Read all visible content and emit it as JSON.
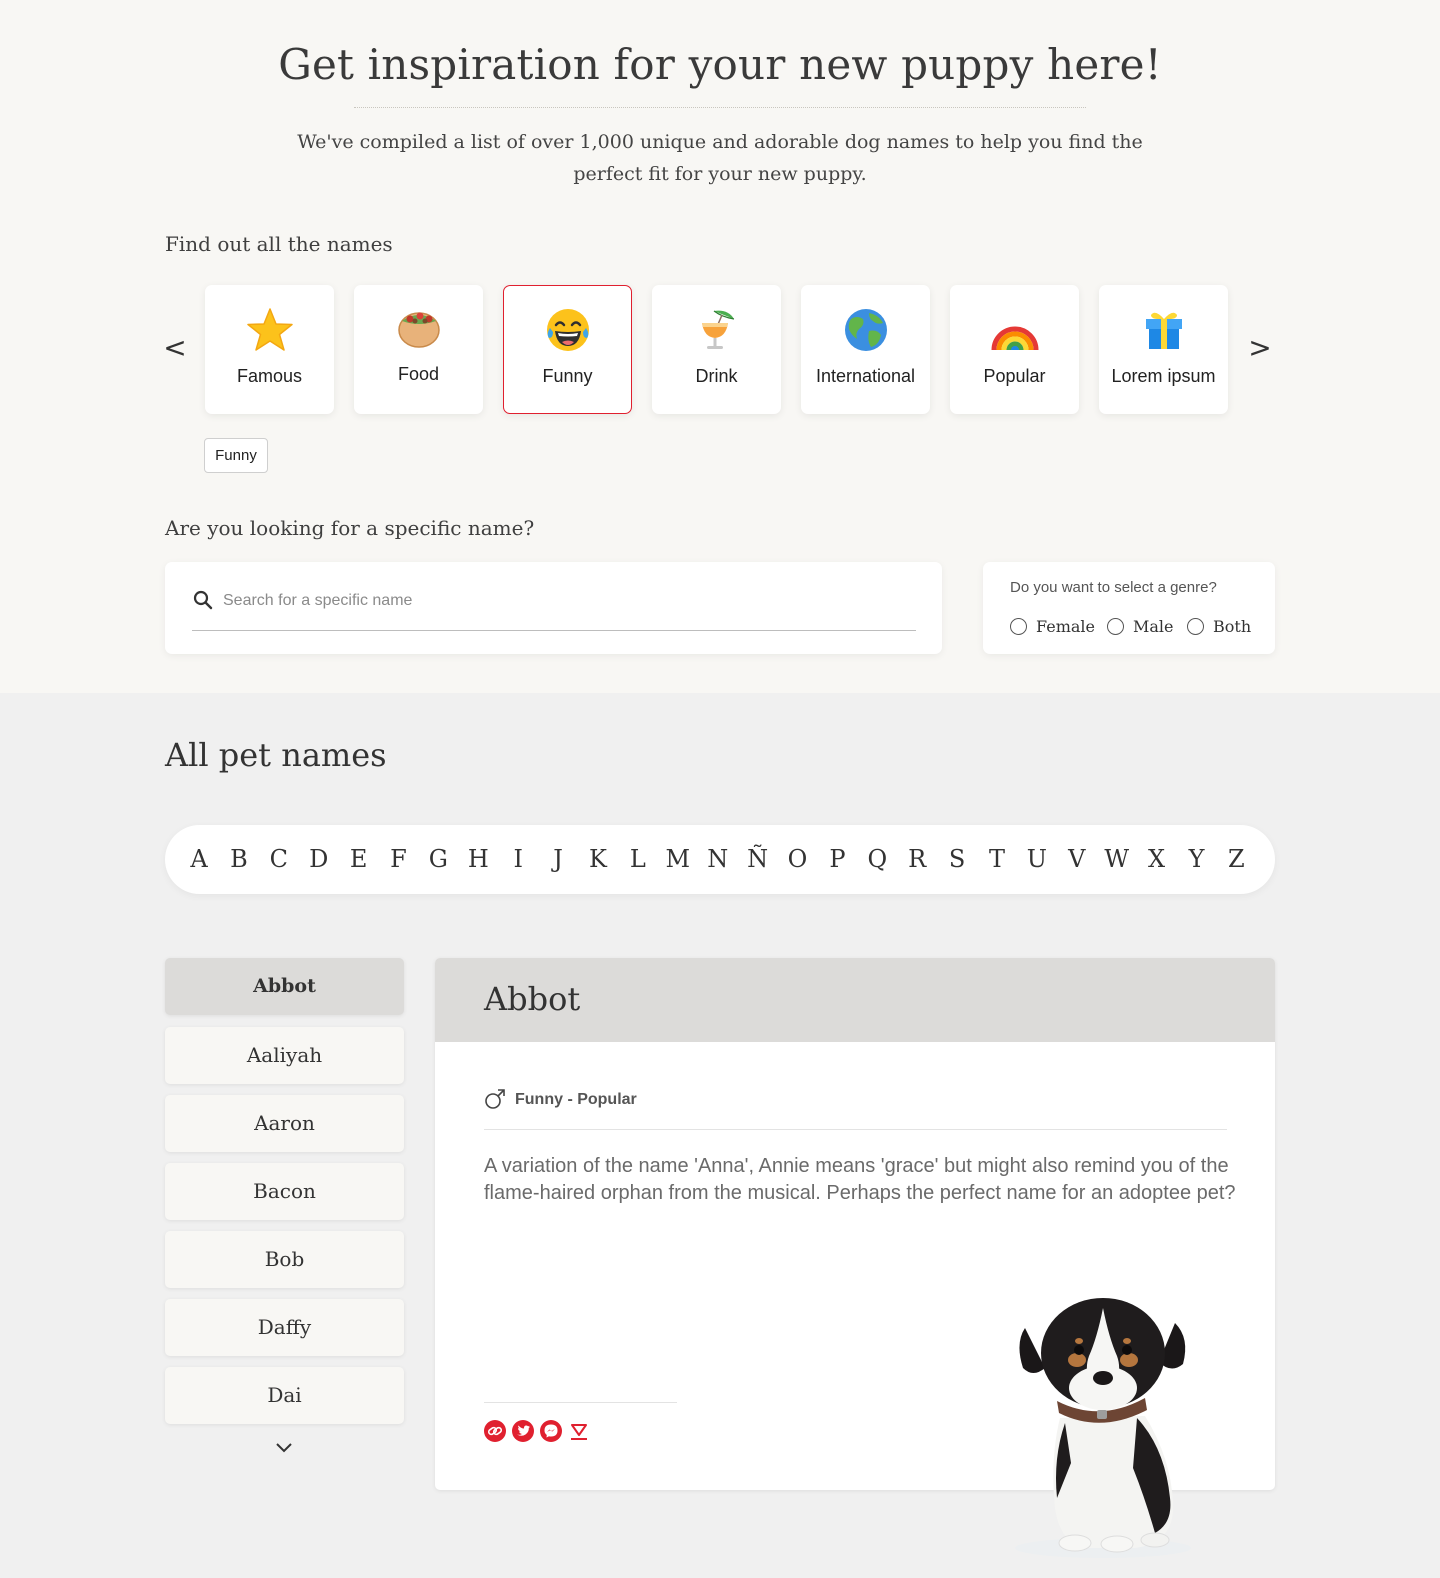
{
  "hero": {
    "title": "Get inspiration for your new puppy here!",
    "subtitle": "We've compiled a list of over 1,000 unique and adorable dog names to help you find the perfect fit for your new puppy."
  },
  "categories": {
    "section_label": "Find out all the names",
    "prev_label": "<",
    "next_label": ">",
    "items": [
      {
        "label": "Famous",
        "icon": "star-icon"
      },
      {
        "label": "Food",
        "icon": "burrito-icon"
      },
      {
        "label": "Funny",
        "icon": "laughing-face-icon",
        "active": true
      },
      {
        "label": "Drink",
        "icon": "tropical-drink-icon"
      },
      {
        "label": "International",
        "icon": "globe-icon"
      },
      {
        "label": "Popular",
        "icon": "rainbow-icon"
      },
      {
        "label": "Lorem ipsum",
        "icon": "gift-icon"
      }
    ],
    "selected_chip": "Funny"
  },
  "search": {
    "section_label": "Are you looking for a specific name?",
    "placeholder": "Search for a specific name",
    "value": ""
  },
  "genre": {
    "question": "Do you want to select a genre?",
    "options": [
      "Female",
      "Male",
      "Both"
    ]
  },
  "pets": {
    "title": "All pet names",
    "letters": [
      "A",
      "B",
      "C",
      "D",
      "E",
      "F",
      "G",
      "H",
      "I",
      "J",
      "K",
      "L",
      "M",
      "N",
      "Ñ",
      "O",
      "P",
      "Q",
      "R",
      "S",
      "T",
      "U",
      "V",
      "W",
      "X",
      "Y",
      "Z"
    ],
    "names": [
      "Abbot",
      "Aaliyah",
      "Aaron",
      "Bacon",
      "Bob",
      "Daffy",
      "Dai"
    ],
    "selected_index": 0
  },
  "detail": {
    "name": "Abbot",
    "gender_icon": "male-icon",
    "tags": "Funny - Popular",
    "description": "A variation of the name 'Anna', Annie means 'grace' but might also remind you of the flame-haired orphan from the musical. Perhaps the perfect name for an adoptee pet?",
    "share_icons": [
      "link-icon",
      "twitter-icon",
      "messenger-icon",
      "pocket-icon"
    ]
  },
  "colors": {
    "accent": "#e0202f",
    "top_bg": "#f8f7f4",
    "bottom_bg": "#f0f0f0",
    "active_name_bg": "#dcdbd9"
  }
}
